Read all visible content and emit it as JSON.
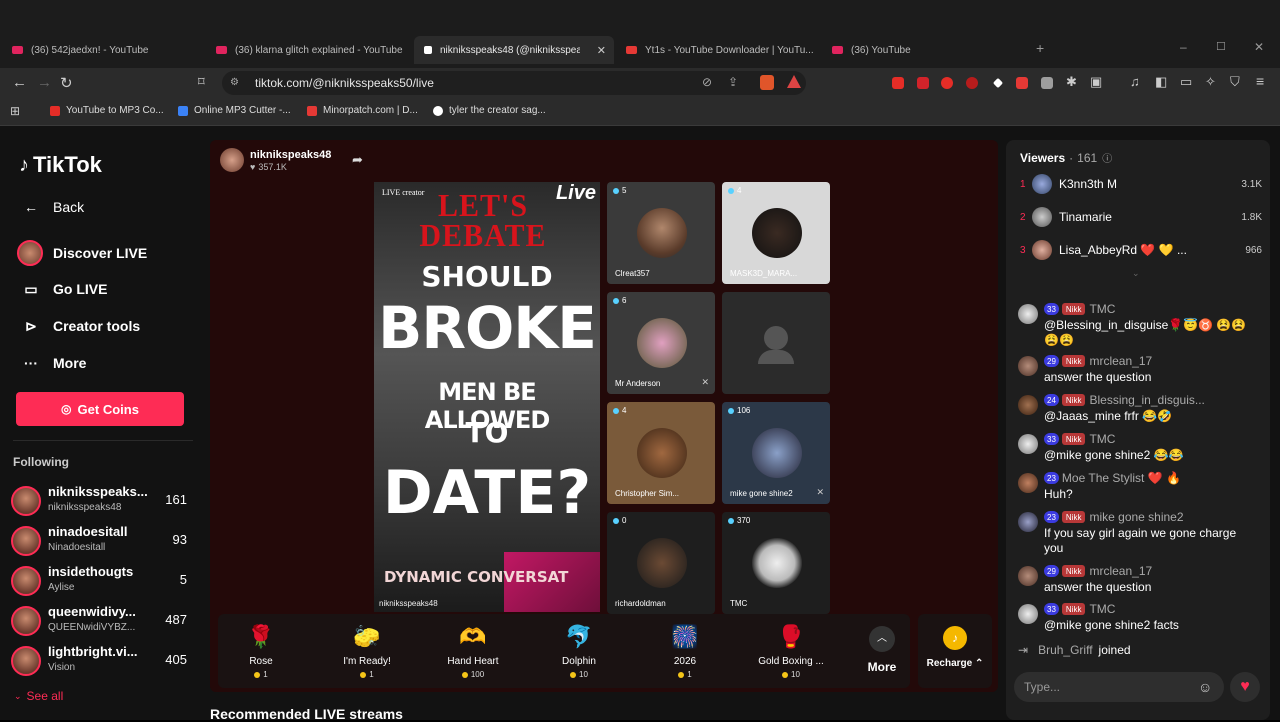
{
  "browser": {
    "tabs": [
      {
        "label": "(36) 542jaedxn! - YouTube"
      },
      {
        "label": "(36) klarna glitch explained - YouTube"
      },
      {
        "label": "nikniksspeaks48 (@nikniksspeaks..."
      },
      {
        "label": "Yt1s - YouTube Downloader | YouTu..."
      },
      {
        "label": "(36) YouTube"
      }
    ],
    "url": "tiktok.com/@nikniksspeaks50/live",
    "bookmarks": [
      {
        "label": "YouTube to MP3 Co..."
      },
      {
        "label": "Online MP3 Cutter -..."
      },
      {
        "label": "Minorpatch.com | D..."
      },
      {
        "label": "tyler the creator sag..."
      }
    ]
  },
  "sidebar": {
    "brand": "TikTok",
    "nav": [
      {
        "label": "Back",
        "icon": "arrow-left-icon"
      },
      {
        "label": "Discover LIVE",
        "icon": "live-avatar-icon"
      },
      {
        "label": "Go LIVE",
        "icon": "video-camera-icon"
      },
      {
        "label": "Creator tools",
        "icon": "play-square-icon"
      },
      {
        "label": "More",
        "icon": "ellipsis-icon"
      }
    ],
    "get_coins": "Get Coins",
    "following_title": "Following",
    "following": [
      {
        "name": "nikniksspeaks...",
        "sub": "nikniksspeaks48",
        "count": "161"
      },
      {
        "name": "ninadoesitall",
        "sub": "Ninadoesitall",
        "count": "93"
      },
      {
        "name": "insidethougts",
        "sub": "Aylise",
        "count": "5"
      },
      {
        "name": "queenwidivy...",
        "sub": "QUEENwidiVYBZ...",
        "count": "487"
      },
      {
        "name": "lightbright.vi...",
        "sub": "Vision",
        "count": "405"
      }
    ],
    "see_all": "See all"
  },
  "stream": {
    "host_name": "niknikspeaks48",
    "host_likes": "357.1K",
    "video": {
      "live_creator": "LIVE creator",
      "live_tag": "Live",
      "headline_1": "LET'S",
      "headline_2": "DEBATE",
      "line_should": "SHOULD",
      "line_broke": "BROKE",
      "line_men": "MEN BE ALLOWED",
      "line_to": "TO",
      "line_date": "DATE?",
      "line_dynamic": "DYNAMIC CONVERSAT",
      "host_tag": "nikniksspeaks48"
    },
    "guests": [
      {
        "name": "Clreat357",
        "count": "5",
        "muted": false
      },
      {
        "name": "MASK3D_MARA...",
        "count": "4",
        "muted": false
      },
      {
        "name": "Mr Anderson",
        "count": "6",
        "muted": true
      },
      {
        "name": "",
        "count": "",
        "muted": false,
        "empty": true
      },
      {
        "name": "Christopher Sim...",
        "count": "4",
        "muted": false
      },
      {
        "name": "mike gone shine2",
        "count": "106",
        "muted": true
      },
      {
        "name": "richardoldman",
        "count": "0",
        "muted": false
      },
      {
        "name": "TMC",
        "count": "370",
        "muted": false
      }
    ],
    "gifts": [
      {
        "name": "Rose",
        "price": "1",
        "icon": "🌹"
      },
      {
        "name": "I'm Ready!",
        "price": "1",
        "icon": "🧽"
      },
      {
        "name": "Hand Heart",
        "price": "100",
        "icon": "🫶"
      },
      {
        "name": "Dolphin",
        "price": "10",
        "icon": "🐬"
      },
      {
        "name": "2026",
        "price": "1",
        "icon": "🎆"
      },
      {
        "name": "Gold Boxing ...",
        "price": "10",
        "icon": "🥊"
      }
    ],
    "more_label": "More",
    "recharge_label": "Recharge"
  },
  "recommended_title": "Recommended LIVE streams",
  "viewers": {
    "title": "Viewers",
    "count": "161",
    "top": [
      {
        "rank": "1",
        "name": "K3nn3th M",
        "score": "3.1K"
      },
      {
        "rank": "2",
        "name": "Tinamarie",
        "score": "1.8K"
      },
      {
        "rank": "3",
        "name": "Lisa_AbbeyRd ❤️ 💛 ...",
        "score": "966"
      }
    ]
  },
  "chat": [
    {
      "level": "33",
      "badge": "Nikk",
      "name": "TMC",
      "text": "@Blessing_in_disguise🌹😇♉ 😫😫 😩😩"
    },
    {
      "level": "29",
      "badge": "Nikk",
      "name": "mrclean_17",
      "text": "answer the question"
    },
    {
      "level": "24",
      "badge": "Nikk",
      "name": "Blessing_in_disguis...",
      "text": "@Jaaas_mine frfr 😂🤣"
    },
    {
      "level": "33",
      "badge": "Nikk",
      "name": "TMC",
      "text": "@mike gone shine2 😂😂"
    },
    {
      "level": "23",
      "badge": "",
      "name": "Moe The Stylist ❤️ 🔥",
      "text": "Huh?"
    },
    {
      "level": "23",
      "badge": "Nikk",
      "name": "mike gone shine2",
      "text": "If you say girl again we gone charge you"
    },
    {
      "level": "29",
      "badge": "Nikk",
      "name": "mrclean_17",
      "text": "answer the question"
    },
    {
      "level": "33",
      "badge": "Nikk",
      "name": "TMC",
      "text": "@mike gone shine2 facts"
    }
  ],
  "join_event": {
    "name": "Bruh_Griff",
    "action": "joined"
  },
  "type_placeholder": "Type..."
}
